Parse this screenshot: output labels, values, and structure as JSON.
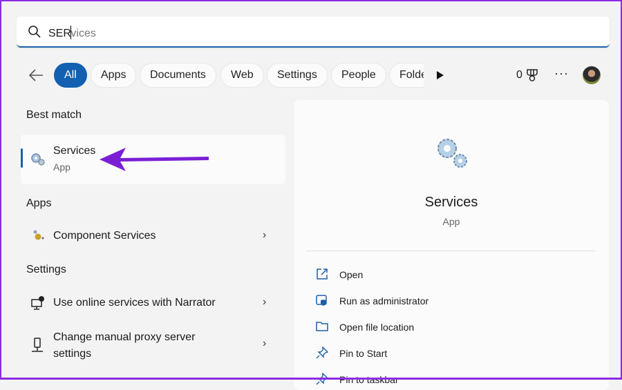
{
  "search": {
    "typed": "SER",
    "suggestion": "vices",
    "icon": "search-icon"
  },
  "filters": {
    "back_icon": "arrow-left-icon",
    "chips": [
      "All",
      "Apps",
      "Documents",
      "Web",
      "Settings",
      "People",
      "Folders"
    ],
    "more_icon": "play-icon",
    "points": "0",
    "rewards_icon": "trophy-icon",
    "menu_icon": "ellipsis-icon"
  },
  "results": {
    "best_match_heading": "Best match",
    "best": {
      "title": "Services",
      "subtitle": "App"
    },
    "apps_heading": "Apps",
    "apps": [
      {
        "label": "Component Services"
      }
    ],
    "settings_heading": "Settings",
    "settings": [
      {
        "label": "Use online services with Narrator"
      },
      {
        "label_line1": "Change manual proxy server",
        "label_line2": "settings"
      }
    ]
  },
  "preview": {
    "title": "Services",
    "subtitle": "App",
    "actions": [
      {
        "label": "Open",
        "icon": "open-external-icon"
      },
      {
        "label": "Run as administrator",
        "icon": "admin-shield-icon"
      },
      {
        "label": "Open file location",
        "icon": "folder-icon"
      },
      {
        "label": "Pin to Start",
        "icon": "pin-icon"
      },
      {
        "label": "Pin to taskbar",
        "icon": "pin-icon"
      }
    ]
  },
  "colors": {
    "accent": "#1360b0",
    "annotation_arrow": "#7b1fd6"
  }
}
